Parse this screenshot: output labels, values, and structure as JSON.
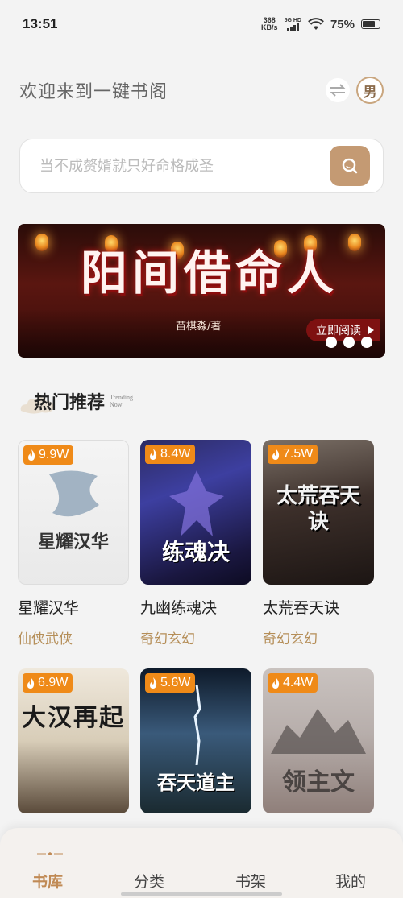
{
  "status_bar": {
    "time": "13:51",
    "net_speed_value": "368",
    "net_speed_unit": "KB/s",
    "network_label": "5G HD",
    "battery_percent": "75%",
    "battery_level": 0.75
  },
  "header": {
    "welcome": "欢迎来到一键书阁",
    "gender": "男"
  },
  "search": {
    "placeholder": "当不成赘婿就只好命格成圣"
  },
  "banner": {
    "title": "阳间借命人",
    "author": "苗棋淼/著",
    "read_button": "立即阅读"
  },
  "section": {
    "title": "热门推荐",
    "subtitle_line1": "Trending",
    "subtitle_line2": "Now"
  },
  "books": [
    {
      "title": "星耀汉华",
      "genre": "仙侠武侠",
      "hot": "9.9W",
      "cover_text": "星耀汉华"
    },
    {
      "title": "九幽练魂决",
      "genre": "奇幻玄幻",
      "hot": "8.4W",
      "cover_text": "练魂决"
    },
    {
      "title": "太荒吞天诀",
      "genre": "奇幻玄幻",
      "hot": "7.5W",
      "cover_text": "太荒吞天诀"
    },
    {
      "hot": "6.9W",
      "cover_text": "大汉再起"
    },
    {
      "hot": "5.6W",
      "cover_text": "吞天道主"
    },
    {
      "hot": "4.4W",
      "cover_text": "领主文"
    }
  ],
  "tabs": [
    {
      "label": "书库"
    },
    {
      "label": "分类"
    },
    {
      "label": "书架"
    },
    {
      "label": "我的"
    }
  ],
  "colors": {
    "accent": "#c49a73",
    "hot_badge": "#ef8a18",
    "genre_text": "#b58e58"
  }
}
